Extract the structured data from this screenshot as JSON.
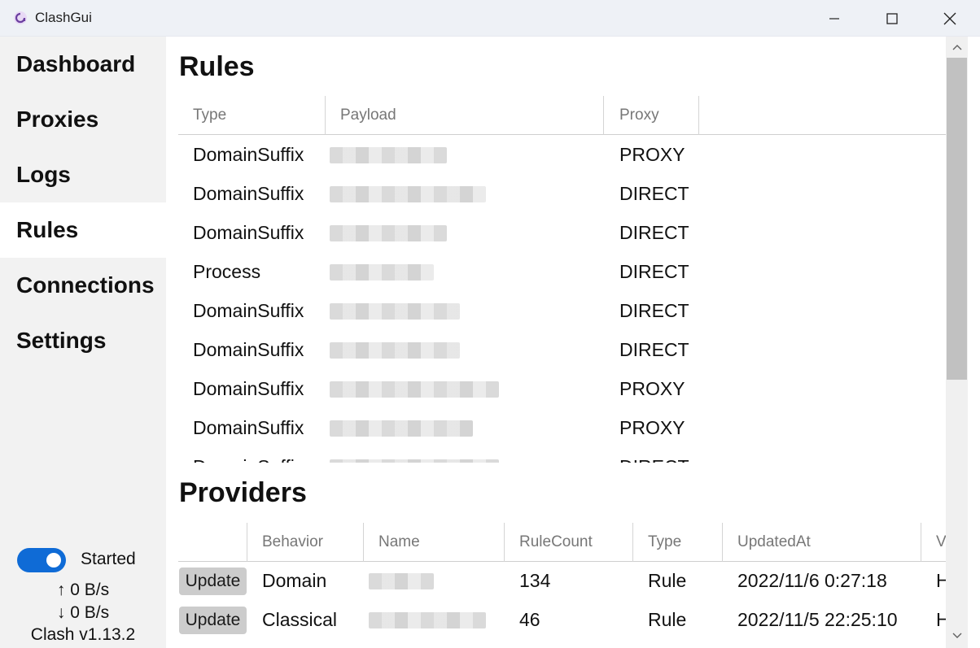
{
  "window": {
    "title": "ClashGui"
  },
  "sidebar": {
    "items": [
      {
        "label": "Dashboard"
      },
      {
        "label": "Proxies"
      },
      {
        "label": "Logs"
      },
      {
        "label": "Rules",
        "active": true
      },
      {
        "label": "Connections"
      },
      {
        "label": "Settings"
      }
    ],
    "status_label": "Started",
    "upload": "↑ 0 B/s",
    "download": "↓ 0 B/s",
    "version": "Clash v1.13.2"
  },
  "rules": {
    "title": "Rules",
    "columns": [
      "Type",
      "Payload",
      "Proxy"
    ],
    "rows": [
      {
        "type": "DomainSuffix",
        "proxy": "PROXY"
      },
      {
        "type": "DomainSuffix",
        "proxy": "DIRECT"
      },
      {
        "type": "DomainSuffix",
        "proxy": "DIRECT"
      },
      {
        "type": "Process",
        "proxy": "DIRECT"
      },
      {
        "type": "DomainSuffix",
        "proxy": "DIRECT"
      },
      {
        "type": "DomainSuffix",
        "proxy": "DIRECT"
      },
      {
        "type": "DomainSuffix",
        "proxy": "PROXY"
      },
      {
        "type": "DomainSuffix",
        "proxy": "PROXY"
      },
      {
        "type": "DomainSuffix",
        "proxy": "DIRECT"
      }
    ]
  },
  "providers": {
    "title": "Providers",
    "columns": [
      "Behavior",
      "Name",
      "RuleCount",
      "Type",
      "UpdatedAt",
      "Vehi"
    ],
    "update_label": "Update",
    "rows": [
      {
        "behavior": "Domain",
        "rule_count": "134",
        "type": "Rule",
        "updated_at": "2022/11/6 0:27:18",
        "vehicle": "HTT"
      },
      {
        "behavior": "Classical",
        "rule_count": "46",
        "type": "Rule",
        "updated_at": "2022/11/5 22:25:10",
        "vehicle": "HTT"
      }
    ]
  },
  "colors": {
    "accent": "#0f6bd6",
    "sidebar_bg": "#f2f2f2",
    "titlebar_bg": "#eef1f6"
  }
}
